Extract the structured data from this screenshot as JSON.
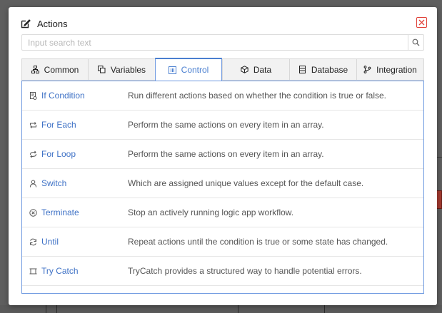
{
  "dialog": {
    "title": "Actions",
    "search": {
      "placeholder": "Input search text",
      "value": ""
    },
    "tabs": [
      {
        "label": "Common",
        "icon": "hierarchy-icon",
        "active": false
      },
      {
        "label": "Variables",
        "icon": "copy-icon",
        "active": false
      },
      {
        "label": "Control",
        "icon": "control-icon",
        "active": true
      },
      {
        "label": "Data",
        "icon": "cube-icon",
        "active": false
      },
      {
        "label": "Database",
        "icon": "database-icon",
        "active": false
      },
      {
        "label": "Integration",
        "icon": "branch-icon",
        "active": false
      }
    ],
    "items": [
      {
        "name": "If Condition",
        "description": "Run different actions based on whether the condition is true or false.",
        "icon": "condition-icon"
      },
      {
        "name": "For Each",
        "description": "Perform the same actions on every item in an array.",
        "icon": "loop-icon"
      },
      {
        "name": "For Loop",
        "description": "Perform the same actions on every item in an array.",
        "icon": "repeat-icon"
      },
      {
        "name": "Switch",
        "description": "Which are assigned unique values except for the default case.",
        "icon": "person-icon"
      },
      {
        "name": "Terminate",
        "description": "Stop an actively running logic app workflow.",
        "icon": "stop-circle-icon"
      },
      {
        "name": "Until",
        "description": "Repeat actions until the condition is true or some state has changed.",
        "icon": "refresh-icon"
      },
      {
        "name": "Try Catch",
        "description": "TryCatch provides a structured way to handle potential errors.",
        "icon": "frame-icon"
      }
    ]
  },
  "colors": {
    "accent": "#4a7fd0",
    "close": "#e0433a",
    "overlay": "#5f5f5f"
  }
}
